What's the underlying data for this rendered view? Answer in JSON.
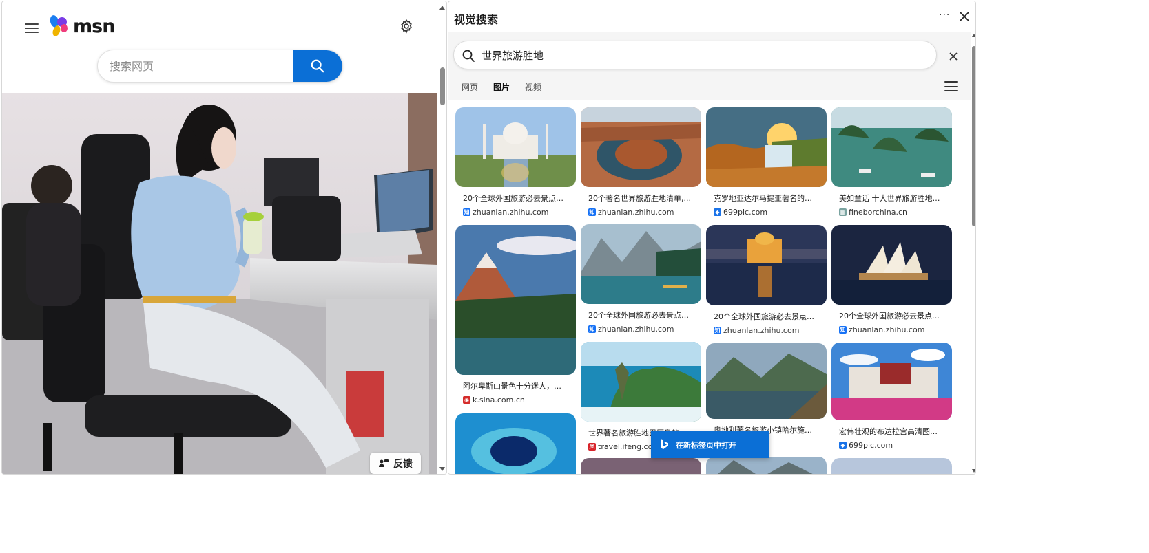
{
  "msn": {
    "logo_text": "msn",
    "search_placeholder": "搜索网页",
    "feedback_label": "反馈",
    "icons": {
      "menu": "hamburger-icon",
      "settings": "gear-icon",
      "search": "search-icon",
      "logo": "msn-butterfly-logo"
    }
  },
  "visual_search": {
    "title": "视觉搜索",
    "more_label": "···",
    "query": "世界旅游胜地",
    "tabs": [
      {
        "label": "网页",
        "active": false
      },
      {
        "label": "图片",
        "active": true
      },
      {
        "label": "视频",
        "active": false
      }
    ],
    "open_in_new_tab_label": "在新标签页中打开",
    "results": [
      {
        "caption": "20个全球外国旅游必去景点，...",
        "source": "zhuanlan.zhihu.com",
        "favicon": "知",
        "favicon_color": "#1772f6"
      },
      {
        "caption": "20个著名世界旅游胜地清单,...",
        "source": "zhuanlan.zhihu.com",
        "favicon": "知",
        "favicon_color": "#1772f6"
      },
      {
        "caption": "克罗地亚达尔马提亚著名的旅...",
        "source": "699pic.com",
        "favicon": "◆",
        "favicon_color": "#1a73e8"
      },
      {
        "caption": "美如童话 十大世界旅游胜地推...",
        "source": "fineborchina.cn",
        "favicon": "▦",
        "favicon_color": "#7aa3a0"
      },
      {
        "caption": "阿尔卑斯山景色十分迷人，是...",
        "source": "k.sina.com.cn",
        "favicon": "◉",
        "favicon_color": "#d52c2b"
      },
      {
        "caption": "20个全球外国旅游必去景点，...",
        "source": "zhuanlan.zhihu.com",
        "favicon": "知",
        "favicon_color": "#1772f6"
      },
      {
        "caption": "20个全球外国旅游必去景点，...",
        "source": "zhuanlan.zhihu.com",
        "favicon": "知",
        "favicon_color": "#1772f6"
      },
      {
        "caption": "20个全球外国旅游必去景点，...",
        "source": "zhuanlan.zhihu.com",
        "favicon": "知",
        "favicon_color": "#1772f6"
      },
      {
        "caption": "世界著名旅游胜地巴厘岛的十...",
        "source": "travel.ifeng.com",
        "favicon": "凤",
        "favicon_color": "#d8232a"
      },
      {
        "caption": "奥地利著名旅游小镇哈尔施塔...",
        "source": "",
        "favicon": "",
        "favicon_color": "#ffffff"
      },
      {
        "caption": "宏伟壮观的布达拉宫高清图片...",
        "source": "699pic.com",
        "favicon": "◆",
        "favicon_color": "#1a73e8"
      }
    ]
  }
}
